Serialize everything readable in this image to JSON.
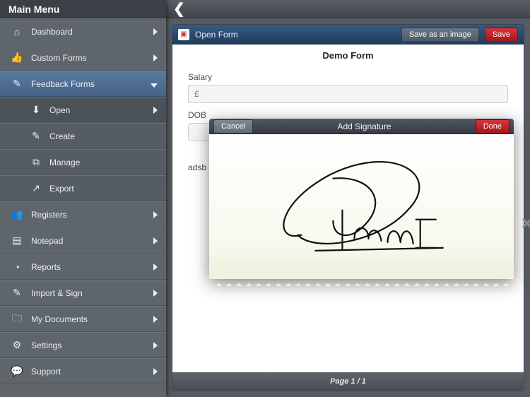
{
  "sidebar": {
    "title": "Main Menu",
    "items": [
      {
        "icon": "home",
        "label": "Dashboard",
        "sub": false,
        "expanded": false
      },
      {
        "icon": "thumb",
        "label": "Custom Forms",
        "sub": false,
        "expanded": false
      },
      {
        "icon": "pencil",
        "label": "Feedback Forms",
        "sub": false,
        "expanded": true
      },
      {
        "icon": "download",
        "label": "Open",
        "sub": true,
        "selected": true
      },
      {
        "icon": "edit",
        "label": "Create",
        "sub": true
      },
      {
        "icon": "copy",
        "label": "Manage",
        "sub": true
      },
      {
        "icon": "share",
        "label": "Export",
        "sub": true
      },
      {
        "icon": "people",
        "label": "Registers",
        "sub": false
      },
      {
        "icon": "notepad",
        "label": "Notepad",
        "sub": false
      },
      {
        "icon": "pie",
        "label": "Reports",
        "sub": false
      },
      {
        "icon": "import",
        "label": "Import & Sign",
        "sub": false
      },
      {
        "icon": "folder",
        "label": "My Documents",
        "sub": false
      },
      {
        "icon": "gear",
        "label": "Settings",
        "sub": false
      },
      {
        "icon": "chat",
        "label": "Support",
        "sub": false
      }
    ]
  },
  "header": {
    "open_form_label": "Open Form",
    "save_image_label": "Save as an image",
    "save_label": "Save"
  },
  "form": {
    "title": "Demo Form",
    "fields": {
      "salary_label": "Salary",
      "salary_placeholder": "£",
      "dob_label": "DOB",
      "adsb_label": "adsb"
    },
    "footer": "Page 1 / 1"
  },
  "signature_modal": {
    "cancel_label": "Cancel",
    "title": "Add Signature",
    "done_label": "Done",
    "close_glyph": "✕"
  },
  "icons": {
    "home": "⌂",
    "thumb": "👍",
    "pencil": "✎",
    "download": "⬇",
    "edit": "✎",
    "copy": "⧉",
    "share": "↗",
    "people": "👥",
    "notepad": "▤",
    "pie": "◔",
    "import": "✎",
    "folder": "🗀",
    "gear": "⚙",
    "chat": "💬"
  }
}
